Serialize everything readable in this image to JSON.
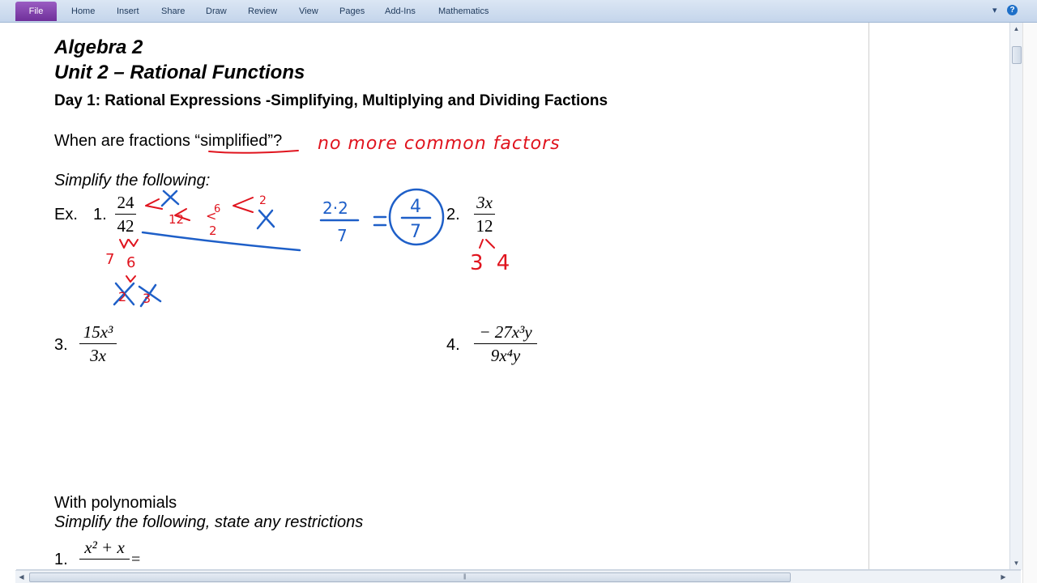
{
  "ribbon": {
    "file": "File",
    "tabs": [
      "Home",
      "Insert",
      "Share",
      "Draw",
      "Review",
      "View",
      "Pages",
      "Add-Ins",
      "Mathematics"
    ],
    "help_icon": "help-icon",
    "collapse_icon": "chevron-down-icon"
  },
  "page": {
    "title1": "Algebra 2",
    "title2": "Unit 2 – Rational Functions",
    "heading": "Day 1:  Rational Expressions  -Simplifying, Multiplying and Dividing Factions",
    "question": "When are fractions “simplified”?",
    "simplify": "Simplify the following:",
    "ex_label": "Ex.",
    "p1_num": "1.",
    "p1_top": "24",
    "p1_bot": "42",
    "p2_num": "2.",
    "p2_top": "3x",
    "p2_bot": "12",
    "p3_num": "3.",
    "p3_top": "15x³",
    "p3_bot": "3x",
    "p4_num": "4.",
    "p4_top": "− 27x³y",
    "p4_bot": "9x⁴y",
    "poly_heading": "With polynomials",
    "poly_instr": "Simplify the following, state any restrictions",
    "q1_num": "1.",
    "q1_top": "x² + x",
    "q1_eq": "="
  },
  "ink": {
    "answer": "no more common factors",
    "result_num": "2·2",
    "result_den": "7",
    "boxed_num": "4",
    "boxed_den": "7",
    "factors_right": "3 4"
  },
  "colors": {
    "ink_red": "#e0141e",
    "ink_blue": "#1e5fc8",
    "file_tab": "#7b3aa8"
  }
}
